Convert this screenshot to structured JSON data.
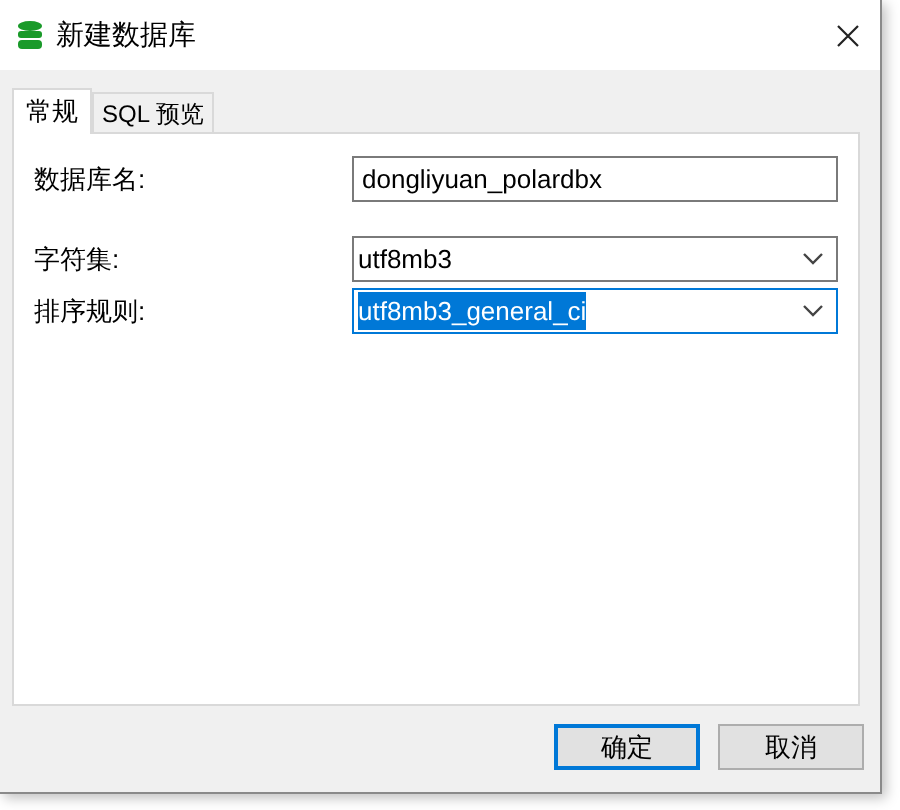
{
  "window": {
    "title": "新建数据库"
  },
  "tabs": [
    {
      "label": "常规",
      "selected": true
    },
    {
      "label": "SQL 预览",
      "selected": false
    }
  ],
  "fields": [
    {
      "label": "数据库名:",
      "value": "dongliyuan_polardbx",
      "kind": "text",
      "focused": false
    },
    {
      "label": "字符集:",
      "value": "utf8mb3",
      "kind": "select",
      "focused": false
    },
    {
      "label": "排序规则:",
      "value": "utf8mb3_general_ci",
      "kind": "select",
      "focused": true
    }
  ],
  "buttons": [
    {
      "label": "确定",
      "default": true
    },
    {
      "label": "取消",
      "default": false
    }
  ]
}
